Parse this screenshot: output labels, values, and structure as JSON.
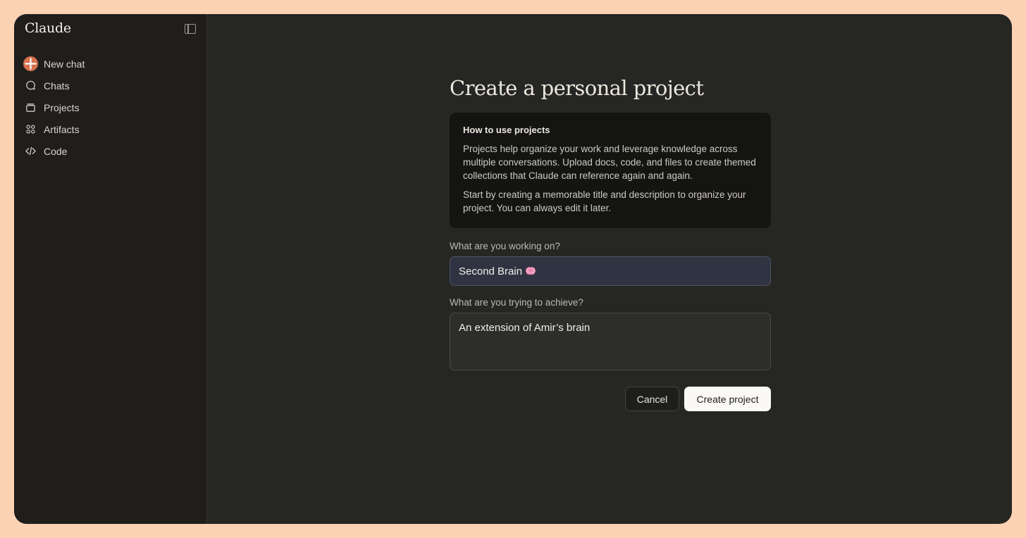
{
  "app": {
    "brand": "Claude"
  },
  "sidebar": {
    "items": [
      {
        "label": "New chat",
        "icon": "plus-icon"
      },
      {
        "label": "Chats",
        "icon": "chat-bubble-icon"
      },
      {
        "label": "Projects",
        "icon": "folder-icon"
      },
      {
        "label": "Artifacts",
        "icon": "artifacts-icon"
      },
      {
        "label": "Code",
        "icon": "code-icon"
      }
    ]
  },
  "main": {
    "title": "Create a personal project",
    "info": {
      "title": "How to use projects",
      "paragraph1": "Projects help organize your work and leverage knowledge across multiple conversations. Upload docs, code, and files to create themed collections that Claude can reference again and again.",
      "paragraph2": "Start by creating a memorable title and description to organize your project. You can always edit it later."
    },
    "form": {
      "name_label": "What are you working on?",
      "name_value": "Second Brain",
      "name_emoji": "brain-icon",
      "goal_label": "What are you trying to achieve?",
      "goal_value": "An extension of Amir’s brain"
    },
    "actions": {
      "cancel_label": "Cancel",
      "create_label": "Create project"
    }
  },
  "colors": {
    "frame": "#fcd2b4",
    "accent": "#d9714f",
    "background": "#262624",
    "sidebar": "#1f1e1d"
  }
}
